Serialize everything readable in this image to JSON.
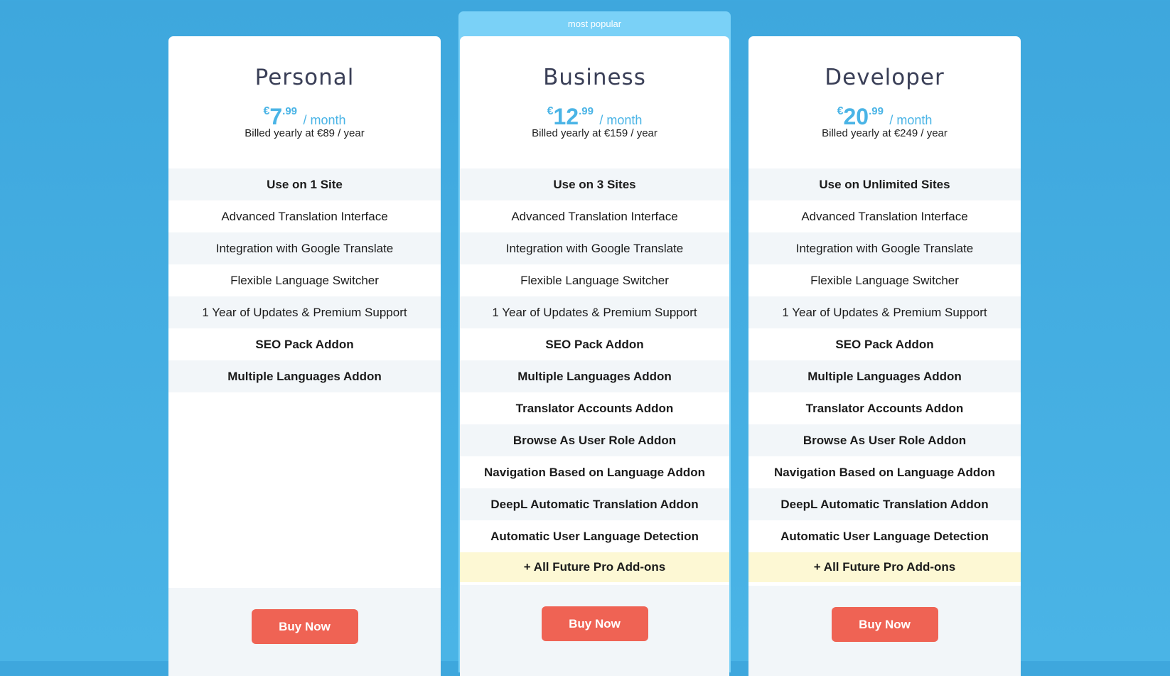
{
  "popular_label": "most popular",
  "colors": {
    "background": "#3ea7dd",
    "accent": "#4ab4e6",
    "popular_banner": "#7ad1f7",
    "buy_button": "#ef6354",
    "highlight_row": "#fdf8d4"
  },
  "plans": [
    {
      "name": "Personal",
      "currency": "€",
      "price_int": "7",
      "price_dec": ".99",
      "period": "/ month",
      "billed": "Billed yearly at €89 / year",
      "features": [
        {
          "label": "Use on 1 Site",
          "bold": true
        },
        {
          "label": "Advanced Translation Interface",
          "bold": false
        },
        {
          "label": "Integration with Google Translate",
          "bold": false
        },
        {
          "label": "Flexible Language Switcher",
          "bold": false
        },
        {
          "label": "1 Year of Updates & Premium Support",
          "bold": false
        },
        {
          "label": "SEO Pack Addon",
          "bold": true
        },
        {
          "label": "Multiple Languages Addon",
          "bold": true
        }
      ],
      "cta": "Buy Now"
    },
    {
      "name": "Business",
      "currency": "€",
      "price_int": "12",
      "price_dec": ".99",
      "period": "/ month",
      "billed": "Billed yearly at €159 / year",
      "features": [
        {
          "label": "Use on 3 Sites",
          "bold": true
        },
        {
          "label": "Advanced Translation Interface",
          "bold": false
        },
        {
          "label": "Integration with Google Translate",
          "bold": false
        },
        {
          "label": "Flexible Language Switcher",
          "bold": false
        },
        {
          "label": "1 Year of Updates & Premium Support",
          "bold": false
        },
        {
          "label": "SEO Pack Addon",
          "bold": true
        },
        {
          "label": "Multiple Languages Addon",
          "bold": true
        },
        {
          "label": "Translator Accounts Addon",
          "bold": true
        },
        {
          "label": "Browse As User Role Addon",
          "bold": true
        },
        {
          "label": "Navigation Based on Language Addon",
          "bold": true
        },
        {
          "label": "DeepL Automatic Translation Addon",
          "bold": true
        },
        {
          "label": "Automatic User Language Detection",
          "bold": true
        }
      ],
      "future": "+ All Future Pro Add-ons",
      "cta": "Buy Now"
    },
    {
      "name": "Developer",
      "currency": "€",
      "price_int": "20",
      "price_dec": ".99",
      "period": "/ month",
      "billed": "Billed yearly at €249 / year",
      "features": [
        {
          "label": "Use on Unlimited Sites",
          "bold": true
        },
        {
          "label": "Advanced Translation Interface",
          "bold": false
        },
        {
          "label": "Integration with Google Translate",
          "bold": false
        },
        {
          "label": "Flexible Language Switcher",
          "bold": false
        },
        {
          "label": "1 Year of Updates & Premium Support",
          "bold": false
        },
        {
          "label": "SEO Pack Addon",
          "bold": true
        },
        {
          "label": "Multiple Languages Addon",
          "bold": true
        },
        {
          "label": "Translator Accounts Addon",
          "bold": true
        },
        {
          "label": "Browse As User Role Addon",
          "bold": true
        },
        {
          "label": "Navigation Based on Language Addon",
          "bold": true
        },
        {
          "label": "DeepL Automatic Translation Addon",
          "bold": true
        },
        {
          "label": "Automatic User Language Detection",
          "bold": true
        }
      ],
      "future": "+ All Future Pro Add-ons",
      "cta": "Buy Now"
    }
  ]
}
